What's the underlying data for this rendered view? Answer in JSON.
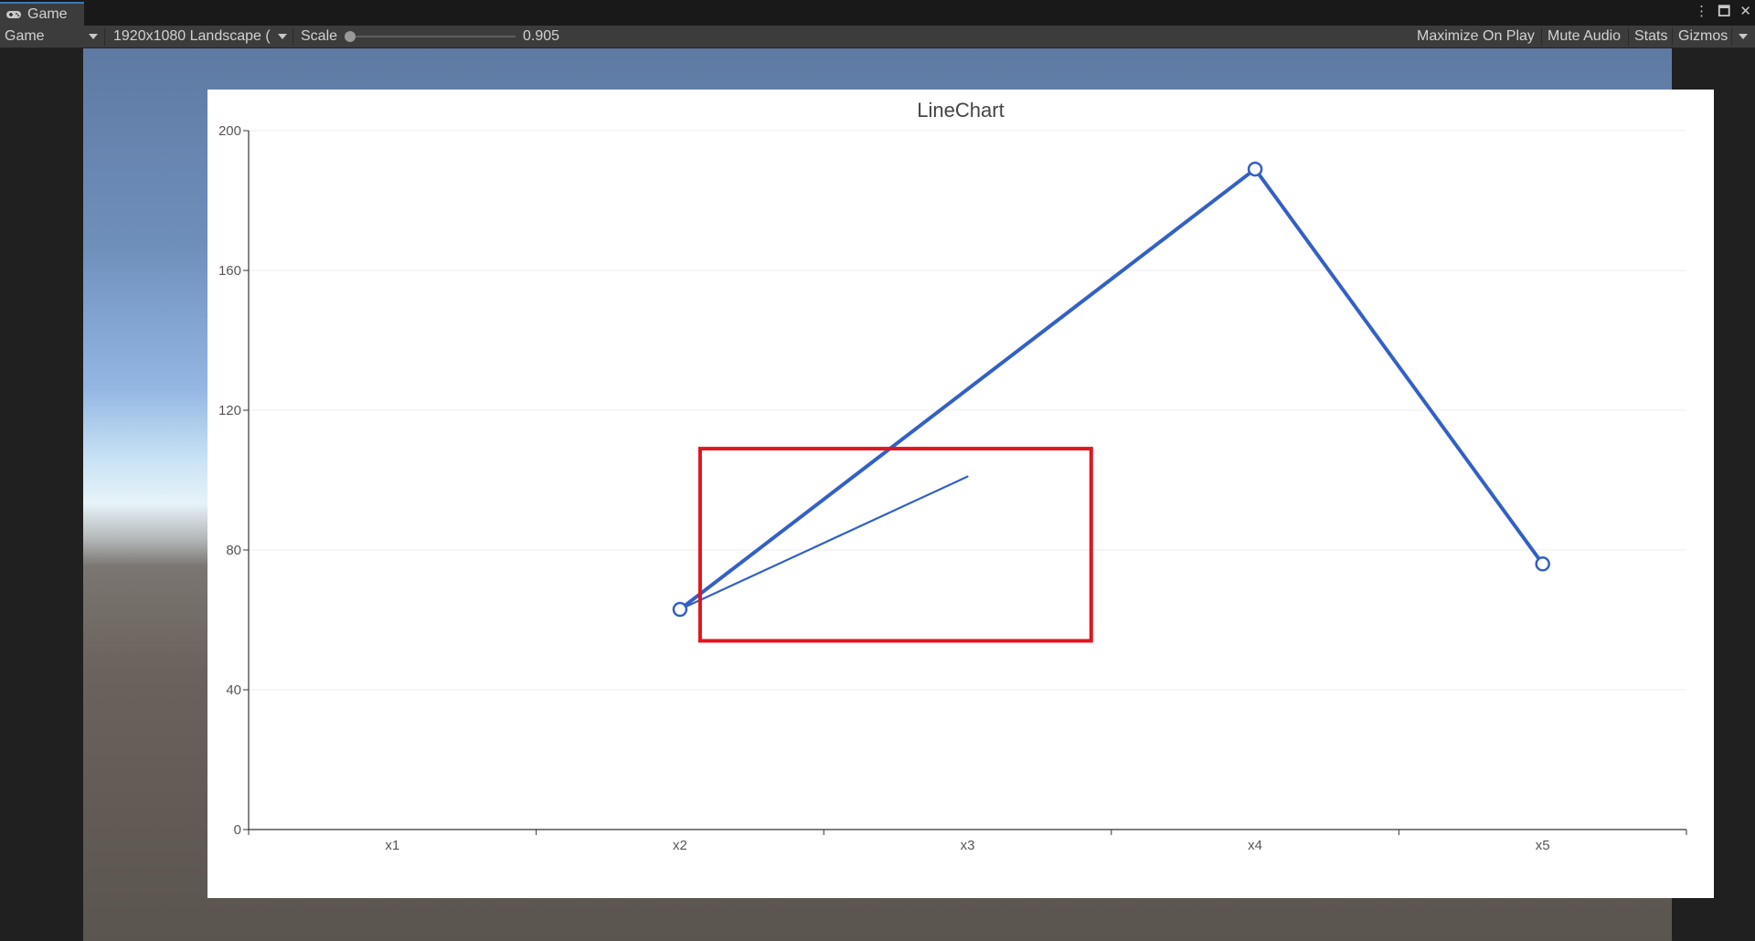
{
  "tab": {
    "label": "Game",
    "icon": "gamepad-icon"
  },
  "window_controls": {
    "menu": "⋮",
    "maximize": "🗖",
    "close": "✕"
  },
  "toolbar": {
    "display_select": "Game",
    "resolution_select": "1920x1080 Landscape (",
    "scale_label": "Scale",
    "scale_value": "0.905",
    "scale_fraction": 0.0,
    "maximize_on_play": "Maximize On Play",
    "mute_audio": "Mute Audio",
    "stats": "Stats",
    "gizmos": "Gizmos"
  },
  "colors": {
    "series": "#3360c4",
    "highlight": "#e0161e",
    "grid": "#ececec",
    "axis": "#333333",
    "label": "#555555"
  },
  "chart_data": {
    "type": "line",
    "title": "LineChart",
    "categories": [
      "x1",
      "x2",
      "x3",
      "x4",
      "x5"
    ],
    "series": [
      {
        "values": [
          null,
          63,
          null,
          189,
          76
        ]
      }
    ],
    "ylim": [
      0,
      200
    ],
    "yticks": [
      0,
      40,
      80,
      120,
      160,
      200
    ],
    "grid": true,
    "extra_segment": {
      "from": [
        1,
        63
      ],
      "to": [
        2.0,
        101
      ]
    },
    "highlight_box": {
      "x": [
        1.57,
        2.93
      ],
      "y": [
        54,
        109
      ]
    }
  }
}
